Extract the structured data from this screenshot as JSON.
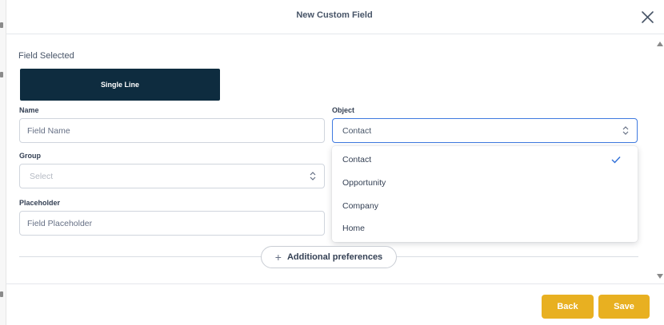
{
  "modal": {
    "title": "New Custom Field"
  },
  "field_selected": {
    "label": "Field Selected",
    "type_label": "Single Line"
  },
  "form": {
    "name": {
      "label": "Name",
      "placeholder": "Field Name"
    },
    "object": {
      "label": "Object",
      "value": "Contact"
    },
    "group": {
      "label": "Group",
      "placeholder": "Select"
    },
    "placeholder": {
      "label": "Placeholder",
      "placeholder": "Field Placeholder"
    }
  },
  "object_dropdown": {
    "options": [
      "Contact",
      "Opportunity",
      "Company",
      "Home"
    ],
    "selected": "Contact"
  },
  "preferences": {
    "label": "Additional preferences"
  },
  "footer": {
    "back_label": "Back",
    "save_label": "Save"
  },
  "colors": {
    "primary_dark": "#0e2c3f",
    "accent_yellow": "#e8b021",
    "focus_blue": "#3f7ae0"
  }
}
